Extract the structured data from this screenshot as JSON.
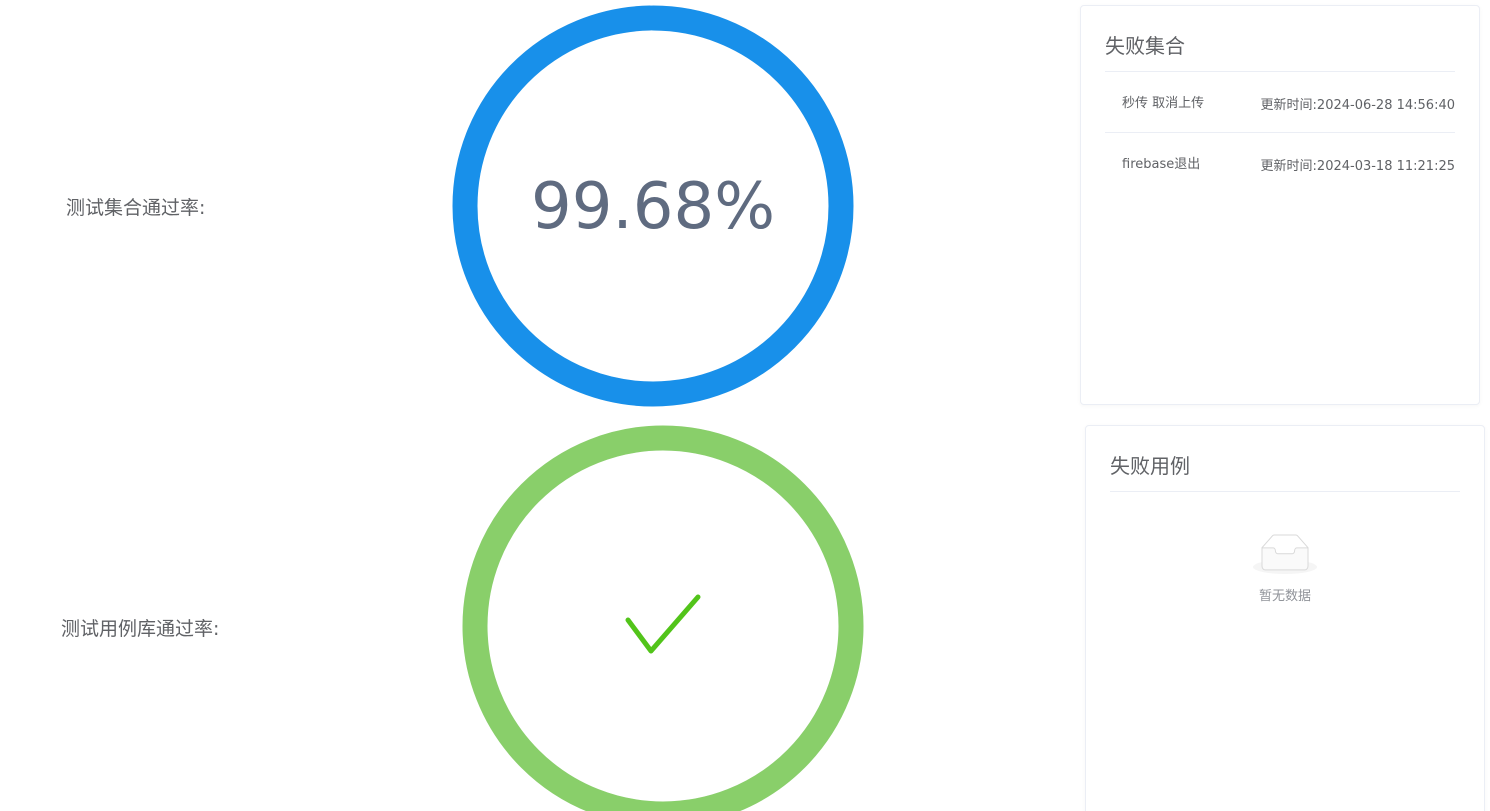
{
  "pass_rate": {
    "suite": {
      "label": "测试集合通过率:",
      "percent": 99.68,
      "text": "99.68%",
      "color": "#1890ea"
    },
    "case_library": {
      "label": "测试用例库通过率:",
      "percent": 100,
      "status": "success",
      "color": "#89cf6a",
      "check_color": "#52c41a",
      "icon": "check-icon"
    }
  },
  "failed_suites": {
    "title": "失败集合",
    "items": [
      {
        "name": "秒传 取消上传",
        "time": "更新时间:2024-06-28 14:56:40"
      },
      {
        "name": "firebase退出",
        "time": "更新时间:2024-03-18 11:21:25"
      }
    ]
  },
  "failed_cases": {
    "title": "失败用例",
    "empty_text": "暂无数据",
    "empty_icon": "empty-box-icon"
  }
}
